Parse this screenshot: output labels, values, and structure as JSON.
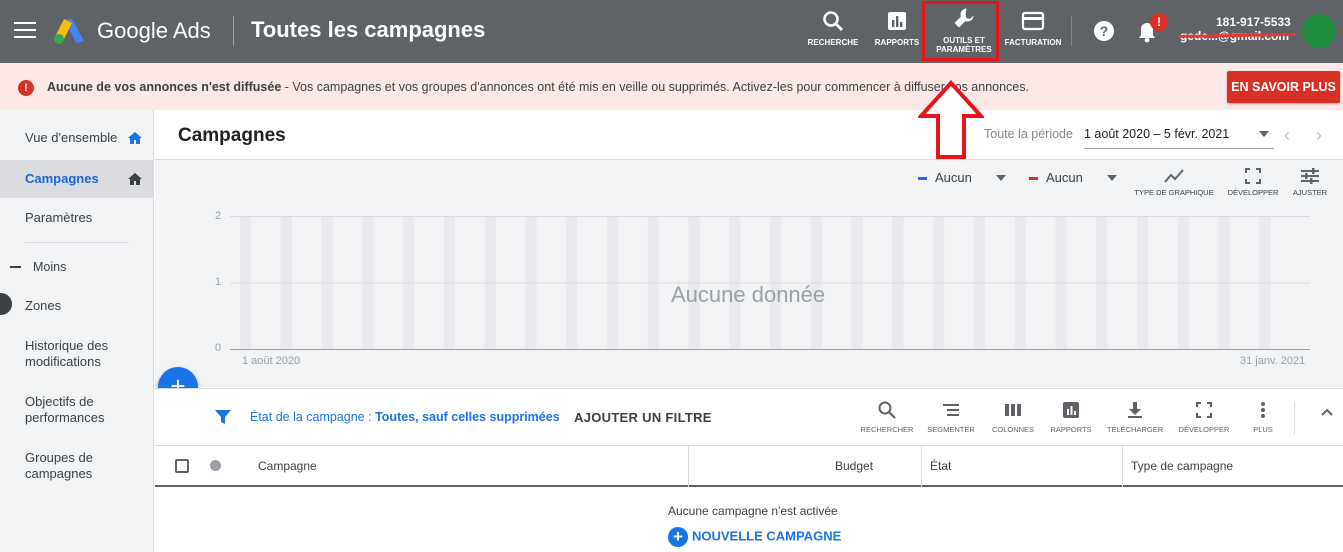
{
  "header": {
    "brand": "Google Ads",
    "title": "Toutes les campagnes",
    "tools": [
      {
        "label": "RECHERCHE",
        "icon": "search-icon"
      },
      {
        "label": "RAPPORTS",
        "icon": "reports-icon"
      },
      {
        "label_line1": "OUTILS ET",
        "label_line2": "PARAMÈTRES",
        "icon": "wrench-icon"
      },
      {
        "label": "FACTURATION",
        "icon": "credit-card-icon"
      }
    ],
    "notification_badge": "!",
    "account_number": "181-917-5533",
    "account_email": "gede...@gmail.com"
  },
  "notice": {
    "bold": "Aucune de vos annonces n'est diffusée",
    "text": " - Vos campagnes et vos groupes d'annonces ont été mis en veille ou supprimés. Activez-les pour commencer à diffuser vos annonces.",
    "button": "EN SAVOIR PLUS"
  },
  "sidebar": {
    "items": [
      {
        "label": "Vue d'ensemble"
      },
      {
        "label": "Campagnes"
      },
      {
        "label": "Paramètres"
      },
      {
        "label": "Moins"
      },
      {
        "label": "Zones"
      },
      {
        "label": "Historique des modifications"
      },
      {
        "label": "Objectifs de performances"
      },
      {
        "label": "Groupes de campagnes"
      }
    ]
  },
  "main": {
    "title": "Campagnes",
    "period_label": "Toute la période",
    "period_value": "1 août 2020 – 5 févr. 2021"
  },
  "chart": {
    "metric1": "Aucun",
    "metric2": "Aucun",
    "tools": [
      "TYPE DE GRAPHIQUE",
      "DÉVELOPPER",
      "AJUSTER"
    ],
    "no_data": "Aucune donnée"
  },
  "chart_data": {
    "type": "line",
    "series": [],
    "y_ticks": [
      "2",
      "1",
      "0"
    ],
    "ylim": [
      0,
      2
    ],
    "x_start_label": "1 août 2020",
    "x_end_label": "31 janv. 2021",
    "annotation": "Aucune donnée",
    "grid": true
  },
  "filter": {
    "label": "État de la campagne : ",
    "value": "Toutes, sauf celles supprimées",
    "add": "AJOUTER UN FILTRE"
  },
  "table_tools": [
    "RECHERCHER",
    "SEGMENTER",
    "COLONNES",
    "RAPPORTS",
    "TÉLÉCHARGER",
    "DÉVELOPPER",
    "PLUS"
  ],
  "table": {
    "columns": [
      "Campagne",
      "Budget",
      "État",
      "Type de campagne"
    ],
    "empty": "Aucune campagne n'est activée",
    "new_campaign": "NOUVELLE CAMPAGNE"
  },
  "colors": {
    "topbar": "#5f6368",
    "accent": "#1a73e8",
    "error": "#d93025",
    "annotation_red": "#e8141c"
  }
}
